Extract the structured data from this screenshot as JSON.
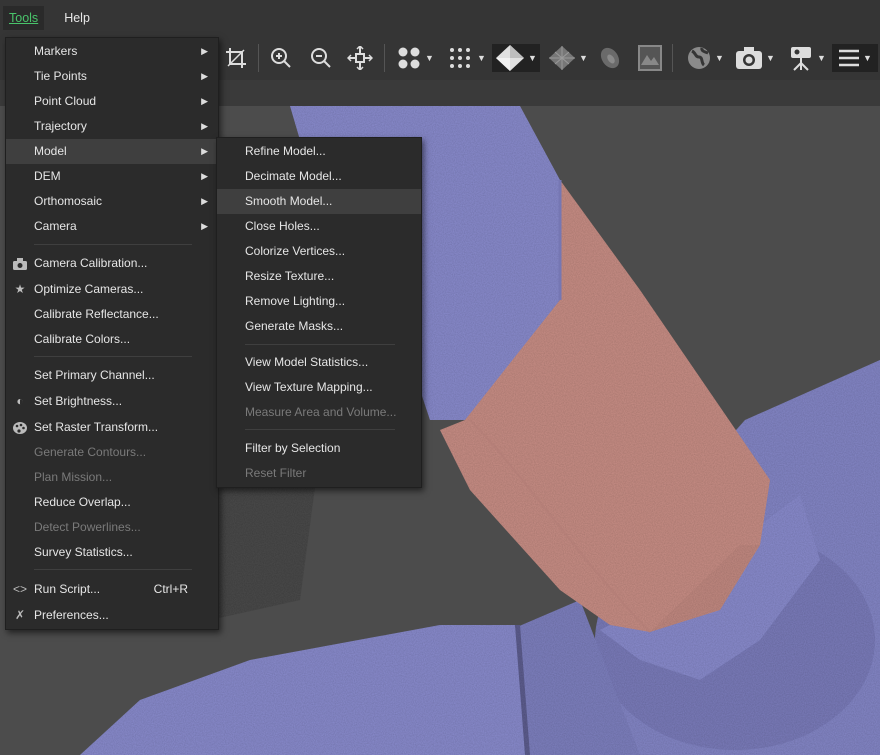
{
  "menubar": {
    "tools": "Tools",
    "help": "Help"
  },
  "toolbar": {
    "icons": [
      "select-icon",
      "crop-icon",
      "zoom-in-icon",
      "zoom-out-icon",
      "pan-icon",
      "point-cloud-icon",
      "dense-cloud-icon",
      "model-solid-icon",
      "model-texture-icon",
      "tiled-model-icon",
      "dem-icon",
      "globe-icon",
      "camera-icon",
      "survey-camera-icon",
      "menu-icon"
    ]
  },
  "tools_menu": {
    "items": [
      {
        "label": "Markers",
        "submenu": true
      },
      {
        "label": "Tie Points",
        "submenu": true
      },
      {
        "label": "Point Cloud",
        "submenu": true
      },
      {
        "label": "Trajectory",
        "submenu": true
      },
      {
        "label": "Model",
        "submenu": true,
        "highlighted": true
      },
      {
        "label": "DEM",
        "submenu": true
      },
      {
        "label": "Orthomosaic",
        "submenu": true
      },
      {
        "label": "Camera",
        "submenu": true
      },
      {
        "label": "Camera Calibration...",
        "icon": "camera-icon"
      },
      {
        "label": "Optimize Cameras...",
        "icon": "star-icon"
      },
      {
        "label": "Calibrate Reflectance..."
      },
      {
        "label": "Calibrate Colors..."
      },
      {
        "label": "Set Primary Channel..."
      },
      {
        "label": "Set Brightness...",
        "icon": "contrast-icon"
      },
      {
        "label": "Set Raster Transform...",
        "icon": "palette-icon"
      },
      {
        "label": "Generate Contours...",
        "disabled": true
      },
      {
        "label": "Plan Mission...",
        "disabled": true
      },
      {
        "label": "Reduce Overlap..."
      },
      {
        "label": "Detect Powerlines...",
        "disabled": true
      },
      {
        "label": "Survey Statistics..."
      },
      {
        "label": "Run Script...",
        "shortcut": "Ctrl+R",
        "icon": "code-icon"
      },
      {
        "label": "Preferences...",
        "icon": "wrench-icon"
      }
    ]
  },
  "model_menu": {
    "items": [
      {
        "label": "Refine Model..."
      },
      {
        "label": "Decimate Model..."
      },
      {
        "label": "Smooth Model...",
        "highlighted": true
      },
      {
        "label": "Close Holes..."
      },
      {
        "label": "Colorize Vertices..."
      },
      {
        "label": "Resize Texture..."
      },
      {
        "label": "Remove Lighting..."
      },
      {
        "label": "Generate Masks..."
      },
      {
        "label": "View Model Statistics..."
      },
      {
        "label": "View Texture Mapping..."
      },
      {
        "label": "Measure Area and Volume...",
        "disabled": true
      },
      {
        "label": "Filter by Selection"
      },
      {
        "label": "Reset Filter",
        "disabled": true
      }
    ]
  },
  "colors": {
    "mesh": "#8a8ccc",
    "selection": "#c98f86",
    "background": "#4c4c4c",
    "menu": "#2b2b2b",
    "accent": "#49c46b"
  }
}
